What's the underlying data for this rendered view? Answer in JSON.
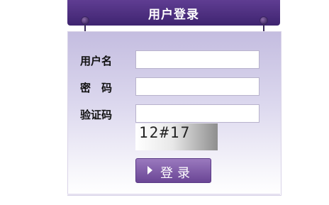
{
  "header": {
    "title": "用户登录"
  },
  "form": {
    "username_label": "用户名",
    "password_label": "密　码",
    "captcha_label": "验证码",
    "username_value": "",
    "password_value": "",
    "captcha_value": "",
    "captcha_text": "12#17"
  },
  "actions": {
    "login_label": "登录"
  },
  "colors": {
    "header": "#4f3180",
    "panel_top": "#c4bde0",
    "panel_bottom": "#ffffff",
    "button": "#7d58a8"
  }
}
